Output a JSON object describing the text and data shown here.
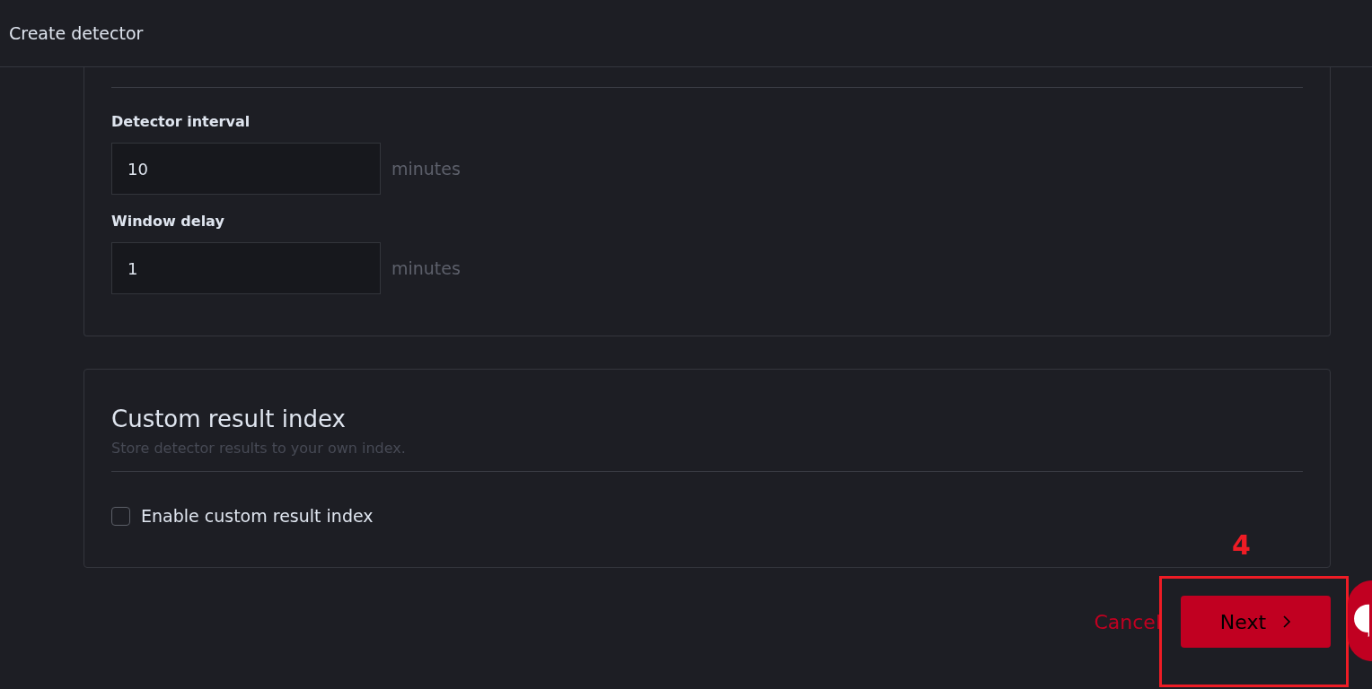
{
  "header": {
    "title": "Create detector"
  },
  "fields": [
    {
      "label": "Detector interval",
      "value": "10",
      "unit": "minutes"
    },
    {
      "label": "Window delay",
      "value": "1",
      "unit": "minutes"
    }
  ],
  "custom_index": {
    "title": "Custom result index",
    "description": "Store detector results to your own index.",
    "checkbox": {
      "label": "Enable custom result index",
      "checked": false
    }
  },
  "footer": {
    "cancel": "Cancel",
    "next": "Next"
  },
  "annotation": {
    "label": "4"
  }
}
